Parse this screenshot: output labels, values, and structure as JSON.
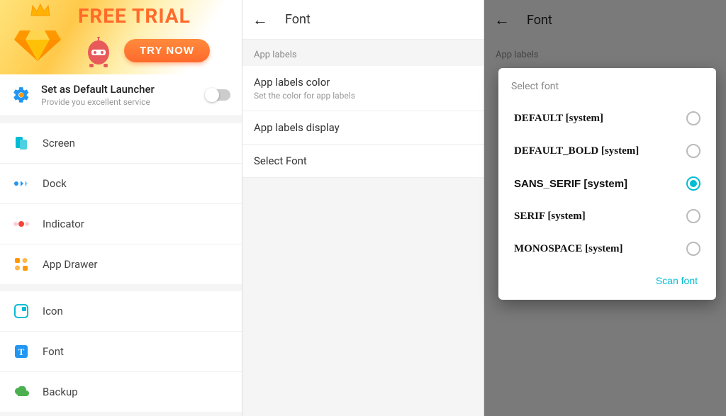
{
  "panel1": {
    "banner": {
      "title": "FREE TRIAL",
      "cta": "TRY NOW"
    },
    "default": {
      "title": "Set as Default Launcher",
      "subtitle": "Provide you excellent service",
      "toggled": false
    },
    "groups": [
      {
        "items": [
          {
            "icon": "screen-icon",
            "label": "Screen",
            "color": "#00bcd4"
          },
          {
            "icon": "dock-icon",
            "label": "Dock",
            "color": "#2196f3"
          },
          {
            "icon": "indicator-icon",
            "label": "Indicator",
            "color": "#f44336"
          },
          {
            "icon": "appdrawer-icon",
            "label": "App Drawer",
            "color": "#ff9800"
          }
        ]
      },
      {
        "items": [
          {
            "icon": "icon-icon",
            "label": "Icon",
            "color": "#00bcd4"
          },
          {
            "icon": "font-icon",
            "label": "Font",
            "color": "#2196f3"
          },
          {
            "icon": "backup-icon",
            "label": "Backup",
            "color": "#4caf50"
          }
        ]
      }
    ]
  },
  "panel2": {
    "title": "Font",
    "section_header": "App labels",
    "rows": [
      {
        "title": "App labels color",
        "subtitle": "Set the color for app labels"
      },
      {
        "title": "App labels display",
        "subtitle": ""
      },
      {
        "title": "Select Font",
        "subtitle": ""
      }
    ]
  },
  "panel3": {
    "title": "Font",
    "section_header": "App labels",
    "dialog": {
      "title": "Select font",
      "options": [
        {
          "label": "DEFAULT [system]",
          "selected": false
        },
        {
          "label": "DEFAULT_BOLD [system]",
          "selected": false
        },
        {
          "label": "SANS_SERIF [system]",
          "selected": true
        },
        {
          "label": "SERIF [system]",
          "selected": false
        },
        {
          "label": "MONOSPACE [system]",
          "selected": false
        }
      ],
      "action": "Scan font"
    }
  }
}
